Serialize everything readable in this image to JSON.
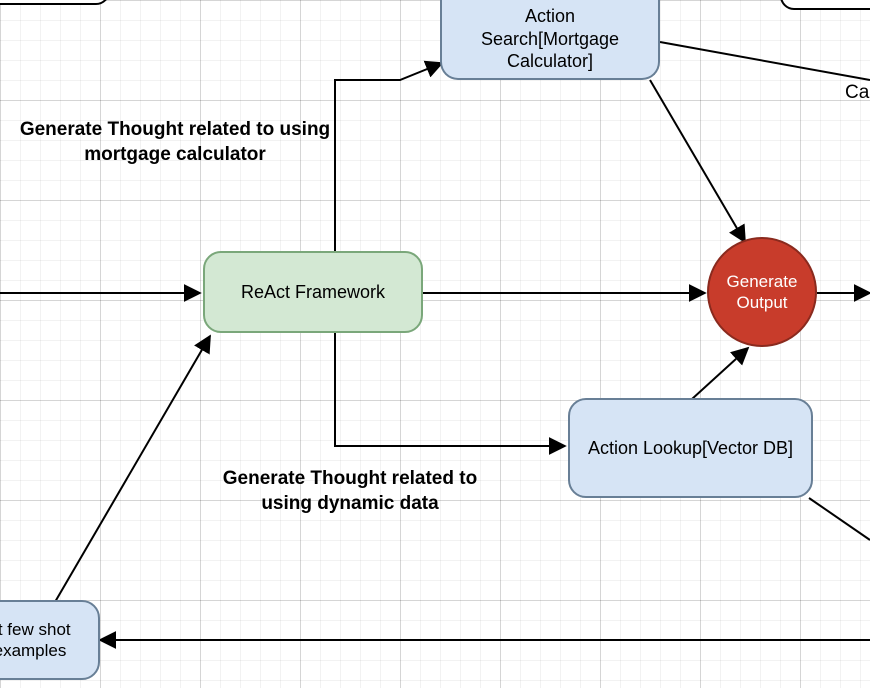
{
  "nodes": {
    "action_search": "Action Search[Mortgage Calculator]",
    "react_framework": "ReAct Framework",
    "action_lookup": "Action Lookup[Vector DB]",
    "generate_output": "Generate Output",
    "few_shot": "ct few shot examples",
    "ca_fragment": "Ca"
  },
  "labels": {
    "thought_mortgage": "Generate Thought related to using mortgage calculator",
    "thought_dynamic": "Generate Thought related to using dynamic data"
  },
  "colors": {
    "blue_fill": "#d6e4f5",
    "blue_stroke": "#687f96",
    "green_fill": "#d3e8d3",
    "green_stroke": "#7aa77a",
    "red_fill": "#c83c2b",
    "red_stroke": "#8a2a1e"
  }
}
